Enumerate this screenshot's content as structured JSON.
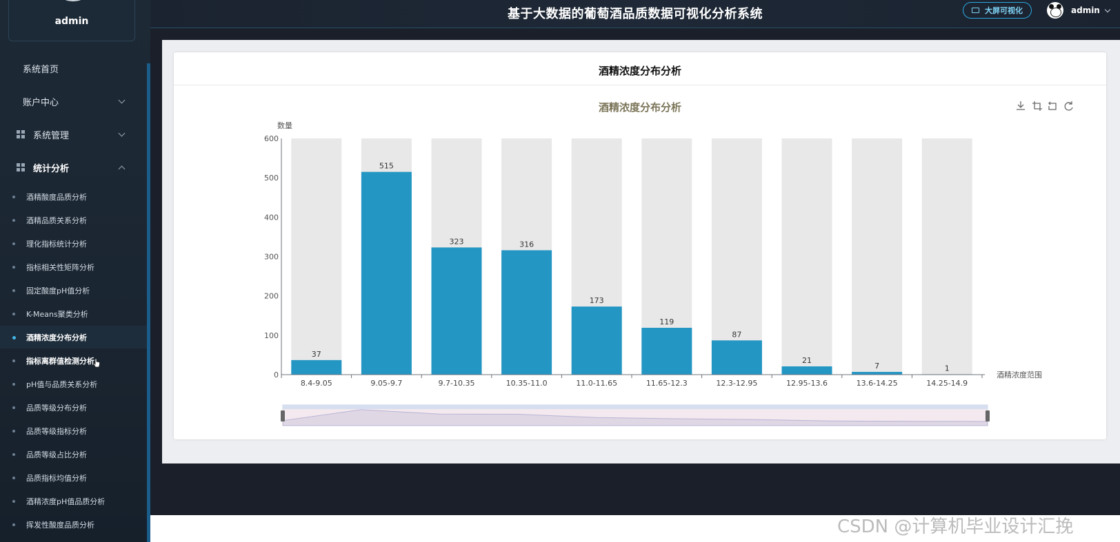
{
  "app": {
    "title": "基于大数据的葡萄酒品质数据可视化分析系统",
    "bigscreen_label": "大屏可视化",
    "username": "admin"
  },
  "sidebar": {
    "user_name": "admin",
    "top_items": [
      {
        "label": "系统首页"
      },
      {
        "label": "账户中心"
      },
      {
        "label": "系统管理"
      },
      {
        "label": "统计分析"
      }
    ],
    "sub_items": [
      {
        "label": "酒精酸度品质分析"
      },
      {
        "label": "酒精品质关系分析"
      },
      {
        "label": "理化指标统计分析"
      },
      {
        "label": "指标相关性矩阵分析"
      },
      {
        "label": "固定酸度pH值分析"
      },
      {
        "label": "K-Means聚类分析"
      },
      {
        "label": "酒精浓度分布分析"
      },
      {
        "label": "指标离群值检测分析"
      },
      {
        "label": "pH值与品质关系分析"
      },
      {
        "label": "品质等级分布分析"
      },
      {
        "label": "品质等级指标分析"
      },
      {
        "label": "品质等级占比分析"
      },
      {
        "label": "品质指标均值分析"
      },
      {
        "label": "酒精浓度pH值品质分析"
      },
      {
        "label": "挥发性酸度品质分析"
      }
    ],
    "active_sub": "酒精浓度分布分析"
  },
  "card": {
    "title": "酒精浓度分布分析"
  },
  "chart_data": {
    "type": "bar",
    "title": "酒精浓度分布分析",
    "xlabel": "酒精浓度范围",
    "ylabel": "数量",
    "ylim": [
      0,
      600
    ],
    "yticks": [
      0,
      100,
      200,
      300,
      400,
      500,
      600
    ],
    "categories": [
      "8.4-9.05",
      "9.05-9.7",
      "9.7-10.35",
      "10.35-11.0",
      "11.0-11.65",
      "11.65-12.3",
      "12.3-12.95",
      "12.95-13.6",
      "13.6-14.25",
      "14.25-14.9"
    ],
    "values": [
      37,
      515,
      323,
      316,
      173,
      119,
      87,
      21,
      7,
      1
    ],
    "background_bars": true,
    "grid": false,
    "data_zoom": true,
    "bar_color": "#2396c4",
    "background_bar_color": "#e8e8e8"
  },
  "watermark": "CSDN @计算机毕业设计汇挽"
}
